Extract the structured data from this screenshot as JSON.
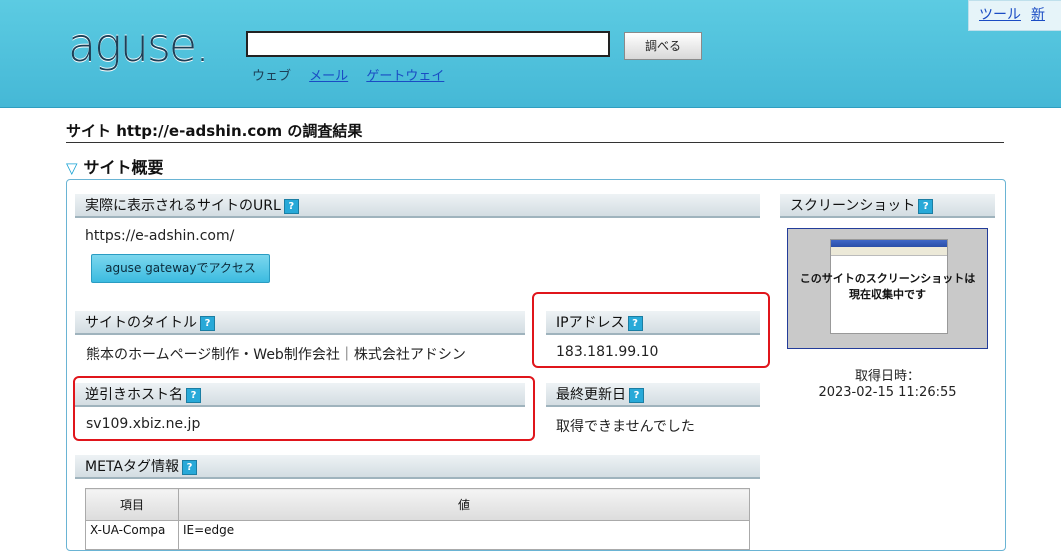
{
  "header": {
    "toplinks": [
      "ツール",
      "新"
    ],
    "logo": "aguse.",
    "search_value": "",
    "search_button": "調べる",
    "nav": {
      "web": "ウェブ",
      "mail": "メール",
      "gateway": "ゲートウェイ"
    }
  },
  "result_title": "サイト http://e-adshin.com の調査結果",
  "section_title": "サイト概要",
  "section_icon": "▽",
  "help_glyph": "?",
  "cards": {
    "url": {
      "label": "実際に表示されるサイトのURL",
      "value": "https://e-adshin.com/",
      "button": "aguse gatewayでアクセス"
    },
    "title": {
      "label": "サイトのタイトル",
      "value": "熊本のホームページ制作・Web制作会社｜株式会社アドシン"
    },
    "ip": {
      "label": "IPアドレス",
      "value": "183.181.99.10"
    },
    "reverse": {
      "label": "逆引きホスト名",
      "value": "sv109.xbiz.ne.jp"
    },
    "updated": {
      "label": "最終更新日",
      "value": "取得できませんでした"
    },
    "meta": {
      "label": "METAタグ情報",
      "columns": [
        "項目",
        "値"
      ],
      "rows": [
        {
          "key": "X-UA-Compa",
          "value": "IE=edge"
        }
      ]
    }
  },
  "screenshot": {
    "label": "スクリーンショット",
    "message_line1": "このサイトのスクリーンショットは",
    "message_line2": "現在収集中です",
    "date_label": "取得日時：",
    "date_value": "2023-02-15 11:26:55"
  },
  "colors": {
    "header_bg": "#45b8d6",
    "highlight": "#e0151b",
    "link": "#1a4cc4",
    "help_badge": "#28a9d8"
  }
}
